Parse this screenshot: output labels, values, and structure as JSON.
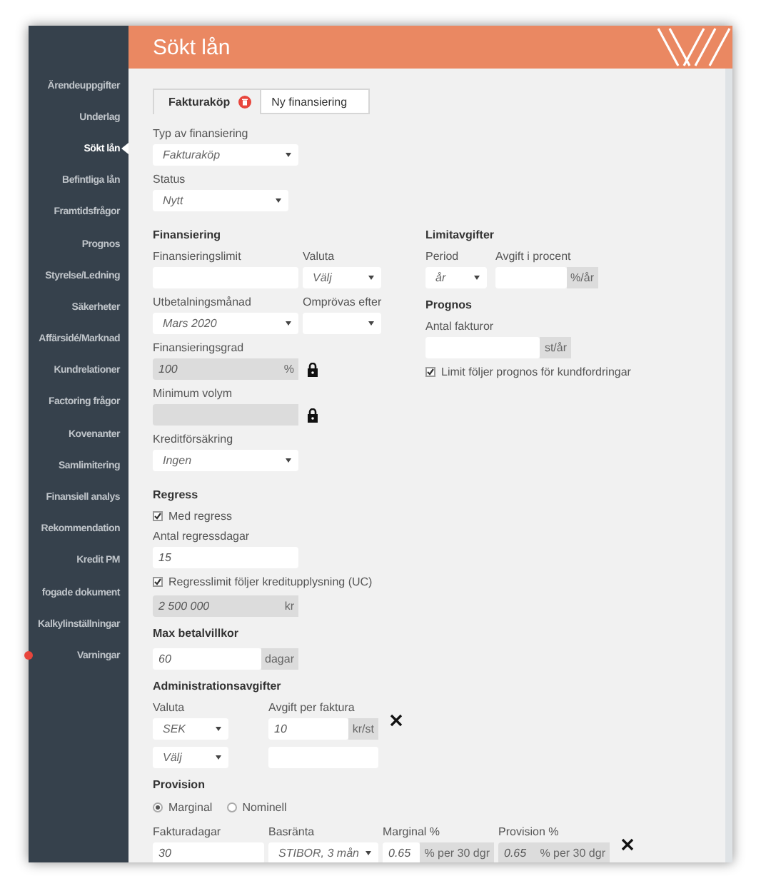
{
  "window": {
    "title": "Sökt lån"
  },
  "sidebar": {
    "items": [
      {
        "label": "Ärendeuppgifter",
        "selected": false,
        "warning": false
      },
      {
        "label": "Underlag",
        "selected": false,
        "warning": false
      },
      {
        "label": "Sökt lån",
        "selected": true,
        "warning": false
      },
      {
        "label": "Befintliga lån",
        "selected": false,
        "warning": false
      },
      {
        "label": "Framtidsfrågor",
        "selected": false,
        "warning": false
      },
      {
        "label": "Prognos",
        "selected": false,
        "warning": false
      },
      {
        "label": "Styrelse/Ledning",
        "selected": false,
        "warning": false
      },
      {
        "label": "Säkerheter",
        "selected": false,
        "warning": false
      },
      {
        "label": "Affärsidé/Marknad",
        "selected": false,
        "warning": false
      },
      {
        "label": "Kundrelationer",
        "selected": false,
        "warning": false
      },
      {
        "label": "Factoring frågor",
        "selected": false,
        "warning": false
      },
      {
        "label": "Kovenanter",
        "selected": false,
        "warning": false
      },
      {
        "label": "Samlimitering",
        "selected": false,
        "warning": false
      },
      {
        "label": "Finansiell analys",
        "selected": false,
        "warning": false
      },
      {
        "label": "Rekommendation",
        "selected": false,
        "warning": false
      },
      {
        "label": "Kredit PM",
        "selected": false,
        "warning": false
      },
      {
        "label": "fogade dokument",
        "selected": false,
        "warning": false
      },
      {
        "label": "Kalkylinställningar",
        "selected": false,
        "warning": false
      },
      {
        "label": "Varningar",
        "selected": false,
        "warning": true
      }
    ]
  },
  "tabs": [
    {
      "label": "Fakturaköp",
      "selected": true,
      "removable": true
    },
    {
      "label": "Ny finansiering",
      "selected": false,
      "removable": false
    }
  ],
  "top_fields": [
    {
      "kind": "select",
      "label": "Typ av finansiering",
      "value": "Fakturaköp"
    },
    {
      "kind": "select",
      "label": "Status",
      "value": "Nytt"
    }
  ],
  "columns": [
    [
      {
        "heading": "Finansiering",
        "rows": [
          [
            {
              "kind": "input",
              "label": "Finansieringslimit"
            },
            {
              "kind": "select",
              "label": "Valuta",
              "value": "Välj"
            }
          ],
          [
            {
              "kind": "select",
              "label": "Utbetalningsmånad",
              "value": "Mars 2020"
            },
            {
              "kind": "select",
              "label": "Omprövas efter"
            }
          ],
          [
            {
              "kind": "input",
              "label": "Finansieringsgrad",
              "value": "100",
              "unit": "%",
              "disabled": true,
              "locked": true
            }
          ],
          [
            {
              "kind": "input",
              "label": "Minimum volym",
              "disabled": true,
              "locked": true
            }
          ],
          [
            {
              "kind": "select",
              "label": "Kreditförsäkring",
              "value": "Ingen"
            }
          ]
        ]
      }
    ],
    [
      {
        "heading": "Limitavgifter",
        "rows": [
          [
            {
              "kind": "select",
              "label": "Period",
              "value": "år"
            },
            {
              "kind": "input",
              "label": "Avgift i procent",
              "unit": "%/år",
              "disabled": false
            }
          ]
        ]
      },
      {
        "heading": "Prognos",
        "rows": [
          [
            {
              "kind": "input",
              "label": "Antal fakturor",
              "unit": "st/år",
              "disabled": false
            }
          ],
          [
            {
              "kind": "checkbox",
              "label": "Limit följer prognos för kundfordringar",
              "checked": true
            }
          ]
        ]
      }
    ]
  ],
  "sections": [
    {
      "heading": "Regress",
      "rows": [
        [
          {
            "kind": "checkbox",
            "label": "Med regress",
            "checked": true
          }
        ],
        [
          {
            "kind": "input",
            "label": "Antal regressdagar",
            "value": "15"
          }
        ],
        [
          {
            "kind": "checkbox",
            "label": "Regresslimit följer kreditupplysning (UC)",
            "checked": true
          }
        ],
        [
          {
            "kind": "input",
            "value": "2 500 000",
            "unit": "kr",
            "disabled": true
          }
        ]
      ]
    },
    {
      "heading": "Max betalvillkor",
      "rows": [
        [
          {
            "kind": "input",
            "value": "60",
            "unit": "dagar",
            "disabled": false
          }
        ]
      ]
    },
    {
      "heading": "Administrationsavgifter",
      "rows": [
        {
          "removable": true,
          "fields": [
            {
              "kind": "select",
              "label": "Valuta",
              "value": "SEK"
            },
            {
              "kind": "input",
              "label": "Avgift per faktura",
              "value": "10",
              "unit": "kr/st",
              "disabled": false
            }
          ]
        },
        {
          "removable": false,
          "fields": [
            {
              "kind": "select",
              "value": "Välj"
            },
            {
              "kind": "input"
            }
          ]
        }
      ]
    },
    {
      "heading": "Provision",
      "rows": [
        {
          "removable": false,
          "fields": [
            {
              "kind": "radio",
              "options": [
                {
                  "label": "Marginal",
                  "selected": true
                },
                {
                  "label": "Nominell",
                  "selected": false
                }
              ]
            }
          ]
        },
        {
          "removable": true,
          "fields": [
            {
              "kind": "input",
              "label": "Fakturadagar",
              "value": "30"
            },
            {
              "kind": "select",
              "label": "Basränta",
              "value": "STIBOR, 3 mån"
            },
            {
              "kind": "input",
              "label": "Marginal %",
              "value": "0.65",
              "unit": "% per 30 dgr",
              "disabled": false
            },
            {
              "kind": "input",
              "label": "Provision %",
              "value": "0.65",
              "unit": "% per 30 dgr",
              "disabled": true
            }
          ]
        }
      ]
    }
  ]
}
